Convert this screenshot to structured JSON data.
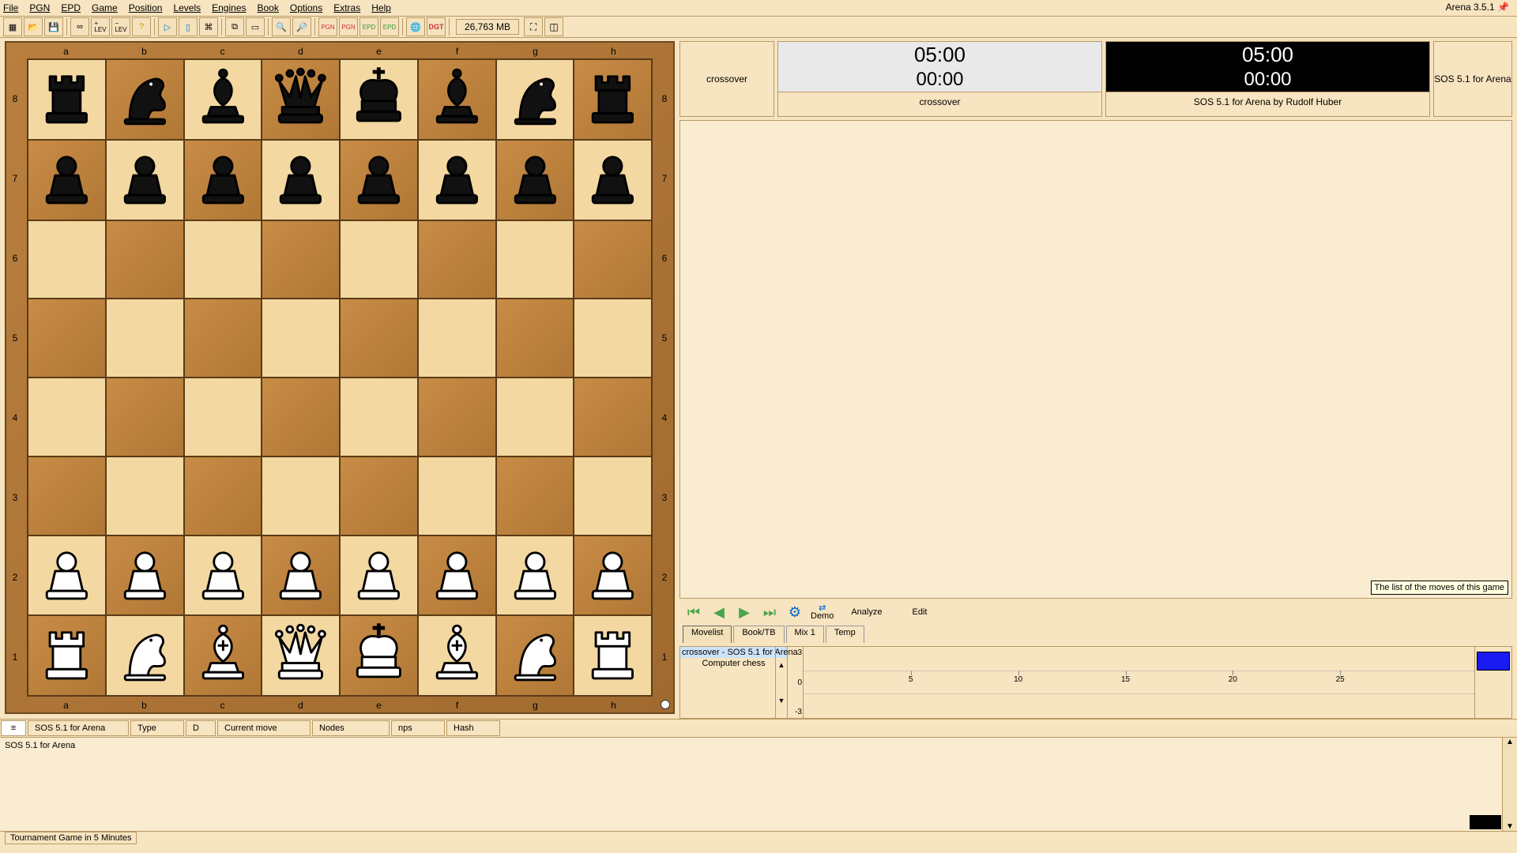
{
  "app_title": "Arena 3.5.1",
  "menu": [
    "File",
    "PGN",
    "EPD",
    "Game",
    "Position",
    "Levels",
    "Engines",
    "Book",
    "Options",
    "Extras",
    "Help"
  ],
  "toolbar": {
    "memory": "26,763 MB",
    "icons": [
      "board",
      "open",
      "save",
      "infinity",
      "lev-plus",
      "lev-minus",
      "lev-q",
      "engine-go",
      "engine-stop",
      "board-setup",
      "copy",
      "window",
      "zoom-in",
      "zoom-out",
      "pgn-in",
      "pgn-out",
      "epd-in",
      "epd-out",
      "globe",
      "dgt"
    ],
    "right": [
      "fullscreen",
      "panels"
    ]
  },
  "board": {
    "files": [
      "a",
      "b",
      "c",
      "d",
      "e",
      "f",
      "g",
      "h"
    ],
    "ranks": [
      "8",
      "7",
      "6",
      "5",
      "4",
      "3",
      "2",
      "1"
    ],
    "rows": [
      [
        "br",
        "bn",
        "bb",
        "bq",
        "bk",
        "bb",
        "bn",
        "br"
      ],
      [
        "bp",
        "bp",
        "bp",
        "bp",
        "bp",
        "bp",
        "bp",
        "bp"
      ],
      [
        "",
        "",
        "",
        "",
        "",
        "",
        "",
        ""
      ],
      [
        "",
        "",
        "",
        "",
        "",
        "",
        "",
        ""
      ],
      [
        "",
        "",
        "",
        "",
        "",
        "",
        "",
        ""
      ],
      [
        "",
        "",
        "",
        "",
        "",
        "",
        "",
        ""
      ],
      [
        "wp",
        "wp",
        "wp",
        "wp",
        "wp",
        "wp",
        "wp",
        "wp"
      ],
      [
        "wr",
        "wn",
        "wb",
        "wq",
        "wk",
        "wb",
        "wn",
        "wr"
      ]
    ]
  },
  "clocks": {
    "left_label": "crossover",
    "right_label": "SOS 5.1 for Arena",
    "white": {
      "main": "05:00",
      "sub": "00:00",
      "name": "crossover"
    },
    "black": {
      "main": "05:00",
      "sub": "00:00",
      "name": "SOS 5.1 for Arena by Rudolf Huber"
    }
  },
  "movelist_tooltip": "The list of the moves of this game",
  "nav": {
    "demo": "Demo",
    "analyze": "Analyze",
    "edit": "Edit"
  },
  "tabs": [
    "Movelist",
    "Book/TB",
    "Mix 1",
    "Temp"
  ],
  "eval": {
    "list": [
      "crossover - SOS 5.1 for Arena",
      "Computer chess"
    ],
    "scale": [
      "3",
      "0",
      "-3"
    ],
    "xticks": [
      "5",
      "10",
      "15",
      "20",
      "25"
    ]
  },
  "status": {
    "engine": "SOS 5.1 for Arena",
    "cols": [
      "Type",
      "D",
      "Current move",
      "Nodes",
      "nps",
      "Hash"
    ]
  },
  "engine_output": "SOS 5.1 for Arena",
  "footer": "Tournament Game in 5 Minutes"
}
